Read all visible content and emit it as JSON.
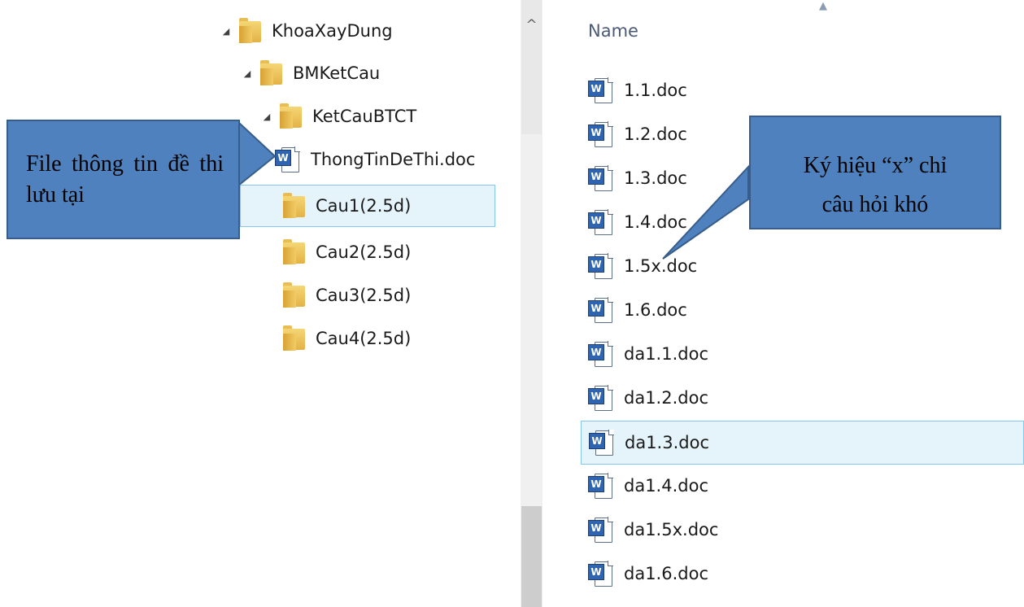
{
  "tree": {
    "items": [
      {
        "label": "KhoaXayDung",
        "kind": "folder",
        "expand": "◢"
      },
      {
        "label": "BMKetCau",
        "kind": "folder",
        "expand": "◢"
      },
      {
        "label": "KetCauBTCT",
        "kind": "folder",
        "expand": "◢"
      },
      {
        "label": "ThongTinDeThi.doc",
        "kind": "doc"
      },
      {
        "label": "Cau1(2.5d)",
        "kind": "folder",
        "selected": true
      },
      {
        "label": "Cau2(2.5d)",
        "kind": "folder"
      },
      {
        "label": "Cau3(2.5d)",
        "kind": "folder"
      },
      {
        "label": "Cau4(2.5d)",
        "kind": "folder"
      }
    ]
  },
  "scrollbar": {
    "up_arrow": "^"
  },
  "file_list": {
    "column_header": "Name",
    "sort_indicator": "▲",
    "files": [
      "1.1.doc",
      "1.2.doc",
      "1.3.doc",
      "1.4.doc",
      "1.5x.doc",
      "1.6.doc",
      "da1.1.doc",
      "da1.2.doc",
      "da1.3.doc",
      "da1.4.doc",
      "da1.5x.doc",
      "da1.6.doc"
    ],
    "selected": "da1.3.doc"
  },
  "icons": {
    "word_glyph": "W"
  },
  "callouts": {
    "left": "File thông tin đề thi lưu tại",
    "right_line1": "Ký hiệu “x” chỉ",
    "right_line2": "câu hỏi khó"
  },
  "colors": {
    "callout_fill": "#4e81bd",
    "selection_fill": "#e5f3fb"
  }
}
